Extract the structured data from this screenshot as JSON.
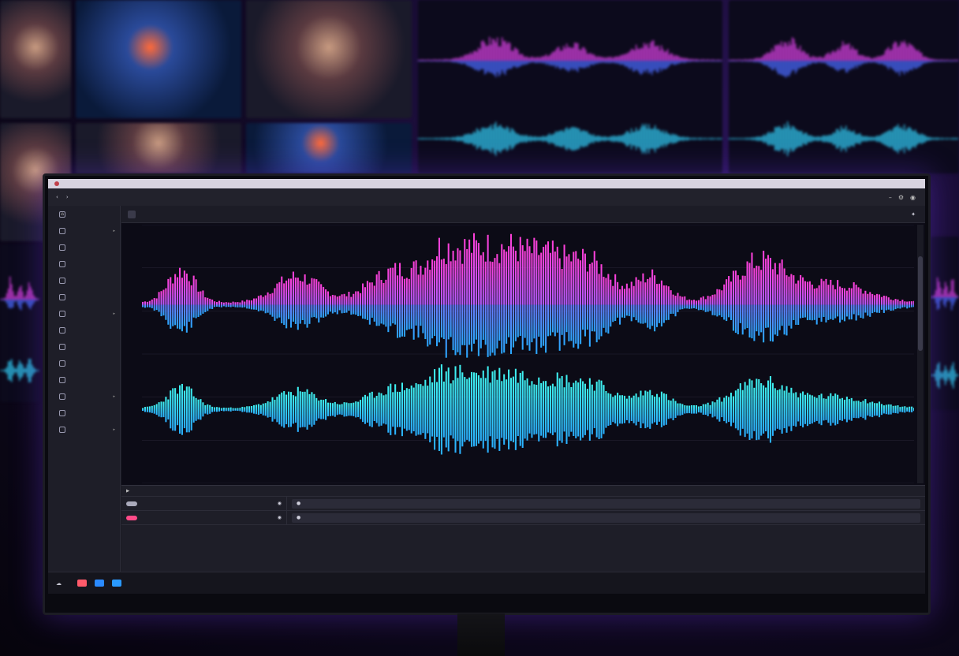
{
  "titlebar": {
    "title": ""
  },
  "menubar": {
    "items": [
      "",
      "",
      "",
      ""
    ]
  },
  "tabs": {
    "items": [
      "",
      "",
      "",
      "",
      ""
    ]
  },
  "subtabs": {
    "items": [
      "",
      "",
      "",
      ""
    ]
  },
  "sidebar": {
    "items": [
      "",
      "",
      "",
      "",
      "",
      "",
      "",
      "",
      "",
      "",
      "",
      "",
      "",
      ""
    ]
  },
  "timeline": {
    "header": "",
    "tracks": [
      {
        "name": "",
        "clip": ""
      },
      {
        "name": "",
        "clip": ""
      }
    ]
  },
  "statusbar": {
    "label": "",
    "clock": ""
  },
  "colors": {
    "accent_pink": "#ff3fd8",
    "accent_blue": "#3a9dff",
    "accent_cyan": "#3ff2f0",
    "record": "#ff5a6a"
  },
  "icons": [
    "close-icon",
    "settings-icon",
    "search-icon",
    "play-icon",
    "eye-icon",
    "plus-icon"
  ]
}
